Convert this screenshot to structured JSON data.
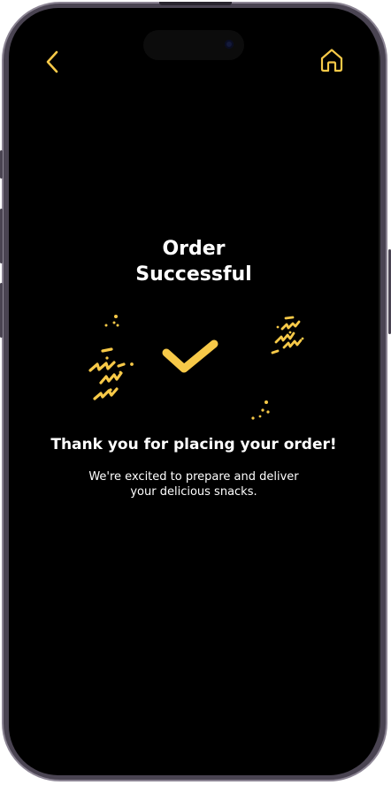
{
  "theme": {
    "accent": "#F7C948",
    "background": "#000000",
    "text": "#FFFFFF"
  },
  "nav": {
    "back_icon": "chevron-left-icon",
    "home_icon": "home-icon"
  },
  "success": {
    "title_line1": "Order",
    "title_line2": "Successful",
    "illustration_icon": "checkmark-confetti-icon",
    "thanks": "Thank you for placing your order!",
    "message_line1": "We're excited to prepare and deliver",
    "message_line2": "your delicious snacks."
  }
}
